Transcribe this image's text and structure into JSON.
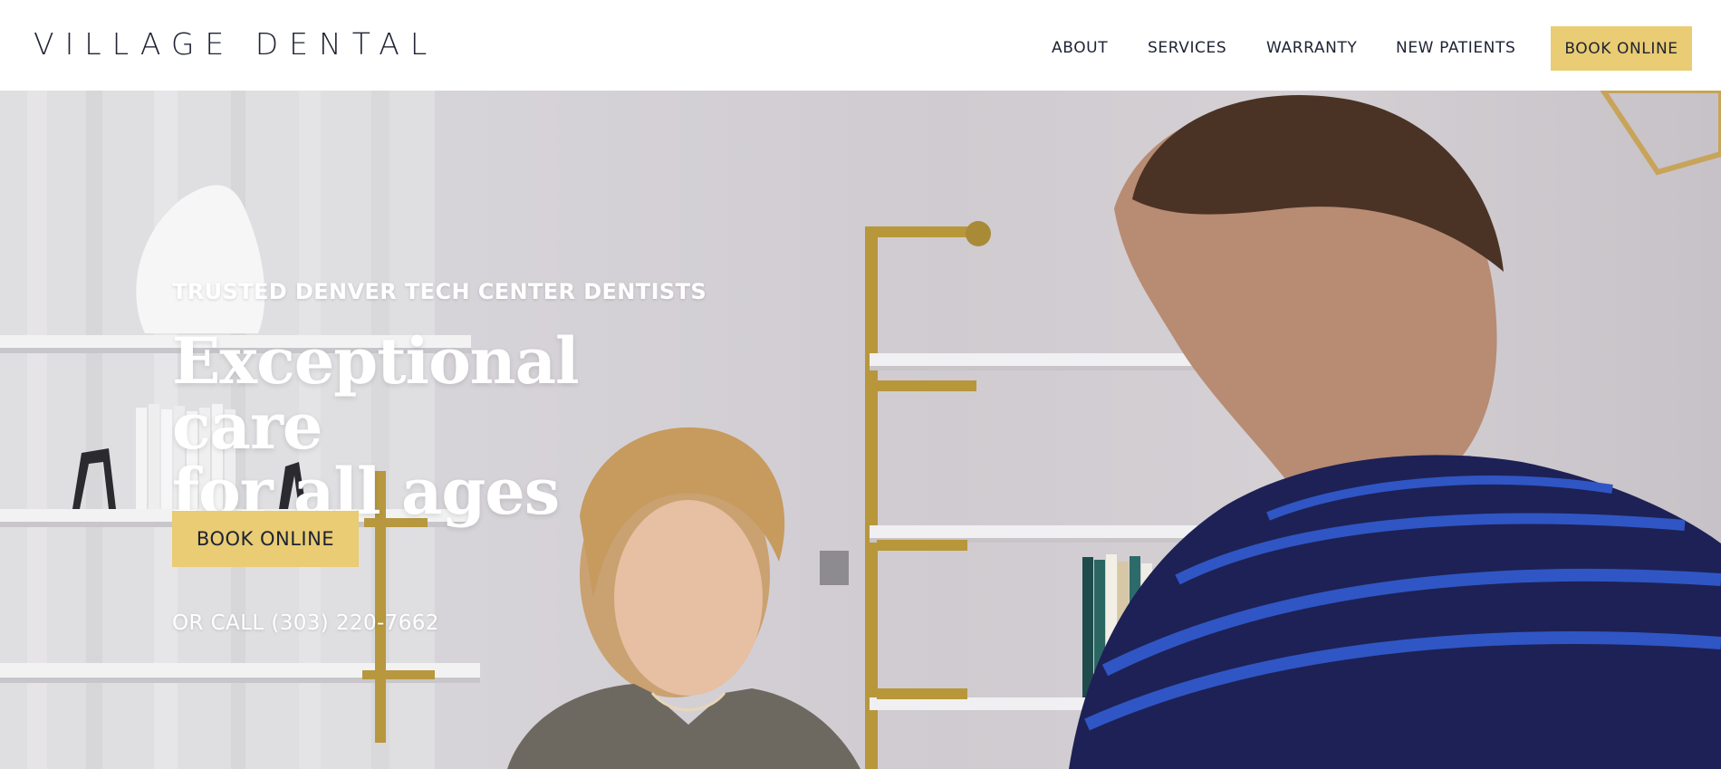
{
  "header": {
    "logo": "VILLAGE DENTAL",
    "nav": {
      "about": "ABOUT",
      "services": "SERVICES",
      "warranty": "WARRANTY",
      "new_patients": "NEW PATIENTS",
      "book_online": "BOOK ONLINE"
    }
  },
  "hero": {
    "eyebrow": "TRUSTED DENVER TECH CENTER DENTISTS",
    "headline_line1": "Exceptional care",
    "headline_line2": "for all ages",
    "book_button": "BOOK ONLINE",
    "call_text": "OR CALL (303) 220-7662"
  },
  "colors": {
    "accent": "#e9cc73",
    "text_dark": "#1e2233",
    "hero_text": "#ffffff"
  }
}
